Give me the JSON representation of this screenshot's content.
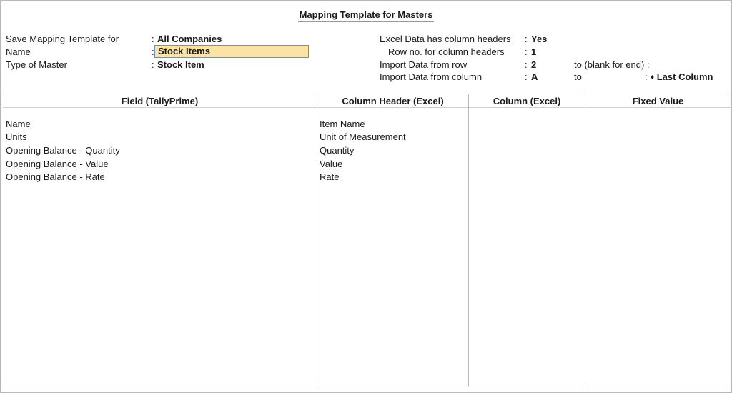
{
  "title": "Mapping Template for Masters",
  "left_fields": [
    {
      "label": "Save Mapping Template for",
      "value": "All Companies"
    },
    {
      "label": "Name",
      "value": "Stock Items"
    },
    {
      "label": "Type of Master",
      "value": "Stock Item"
    }
  ],
  "right_fields": {
    "headers_label": "Excel Data has column headers",
    "headers_value": "Yes",
    "header_row_label": "Row no. for column headers",
    "header_row_value": "1",
    "from_row_label": "Import Data from row",
    "from_row_value": "2",
    "to_row_label": "to (blank for end) :",
    "from_col_label": "Import Data from column",
    "from_col_value": "A",
    "to_col_label": "to",
    "to_col_value": "Last Column"
  },
  "separator": ":",
  "table": {
    "headers": [
      "Field (TallyPrime)",
      "Column Header (Excel)",
      "Column (Excel)",
      "Fixed Value"
    ],
    "rows": [
      {
        "field": "Name",
        "column_header": "Item Name"
      },
      {
        "field": "Units",
        "column_header": "Unit of Measurement"
      },
      {
        "field": "Opening Balance - Quantity",
        "column_header": "Quantity"
      },
      {
        "field": "Opening Balance - Value",
        "column_header": "Value"
      },
      {
        "field": "Opening Balance - Rate",
        "column_header": "Rate"
      }
    ]
  },
  "icons": {
    "to_col_marker": "diamond-icon"
  }
}
